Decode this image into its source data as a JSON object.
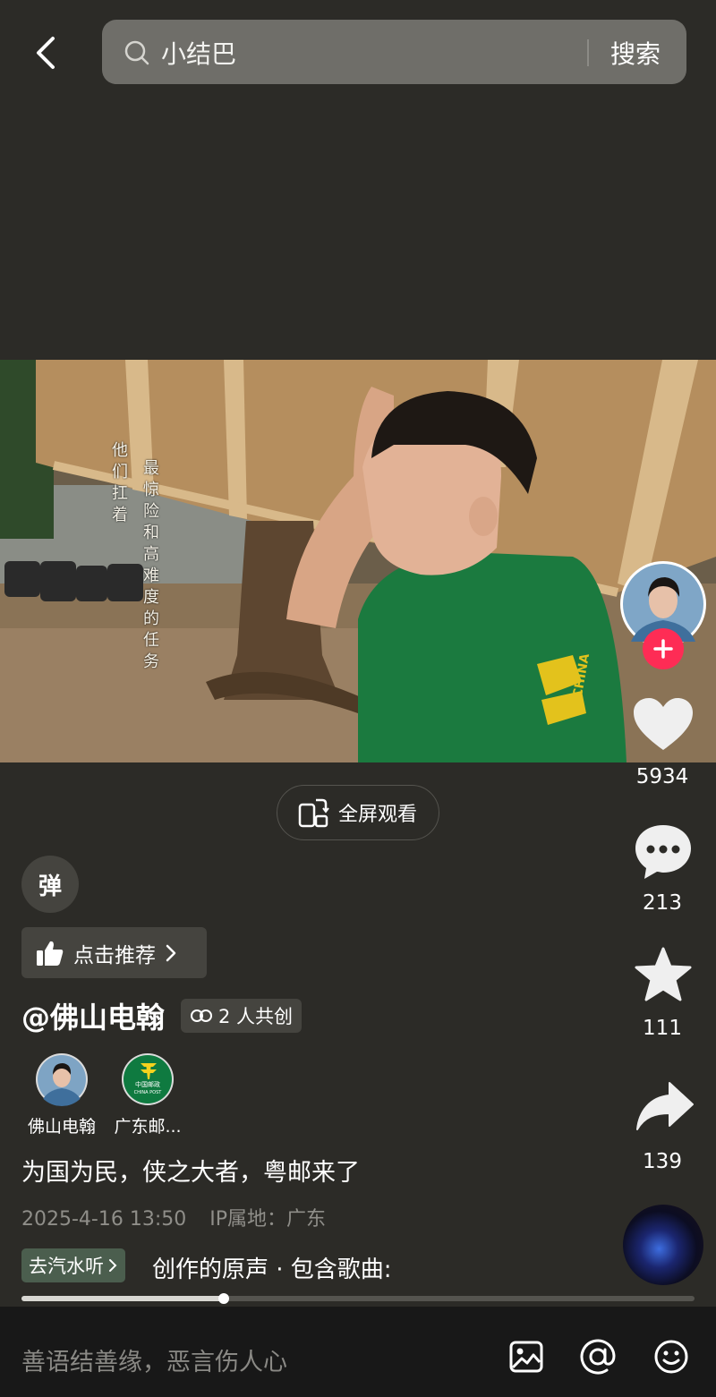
{
  "header": {
    "search_text": "小结巴",
    "search_button": "搜索"
  },
  "video": {
    "overlay_line_1": "他们扛着",
    "overlay_line_2": "最惊险和高难度的任务",
    "shirt_logo_text": "CHINA"
  },
  "fullscreen_label": "全屏观看",
  "sidebar": {
    "likes": "5934",
    "comments": "213",
    "favorites": "111",
    "shares": "139"
  },
  "danmu_label": "弹",
  "recommend_label": "点击推荐",
  "author": {
    "handle": "@佛山电翰",
    "cocreate": "2 人共创"
  },
  "creators": [
    {
      "name": "佛山电翰"
    },
    {
      "name": "广东邮...",
      "logo_text": "中国邮政",
      "logo_subtext": "CHINA POST"
    }
  ],
  "caption": "为国为民，侠之大者，粤邮来了",
  "meta": {
    "date": "2025-4-16 13:50",
    "ip": "IP属地：广东"
  },
  "music": {
    "tag": "去汽水听",
    "text": "创作的原声 · 包含歌曲:"
  },
  "progress": 0.3,
  "comment_bar": {
    "placeholder": "善语结善缘，恶言伤人心"
  },
  "colors": {
    "background": "#2c2b27",
    "follow_plus": "#fe2c55",
    "bottom_bar": "#181818"
  }
}
